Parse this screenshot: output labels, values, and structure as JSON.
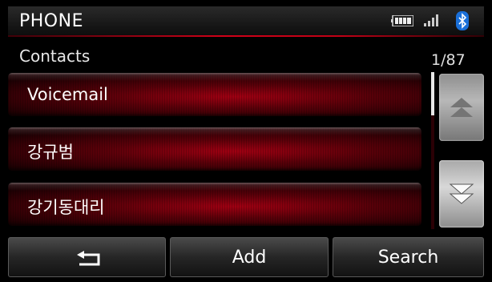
{
  "header": {
    "title": "PHONE",
    "icons": [
      "battery-icon",
      "signal-icon",
      "bluetooth-icon"
    ],
    "accent_color": "#d00018"
  },
  "section": {
    "title": "Contacts",
    "page_counter": "1/87"
  },
  "contacts": [
    {
      "label": "Voicemail"
    },
    {
      "label": "강규범"
    },
    {
      "label": "강기동대리"
    }
  ],
  "scroll": {
    "up_icon": "double-chevron-up-icon",
    "down_icon": "double-chevron-down-icon"
  },
  "bottom_bar": {
    "back_icon": "back-arrow-icon",
    "add_label": "Add",
    "search_label": "Search"
  }
}
